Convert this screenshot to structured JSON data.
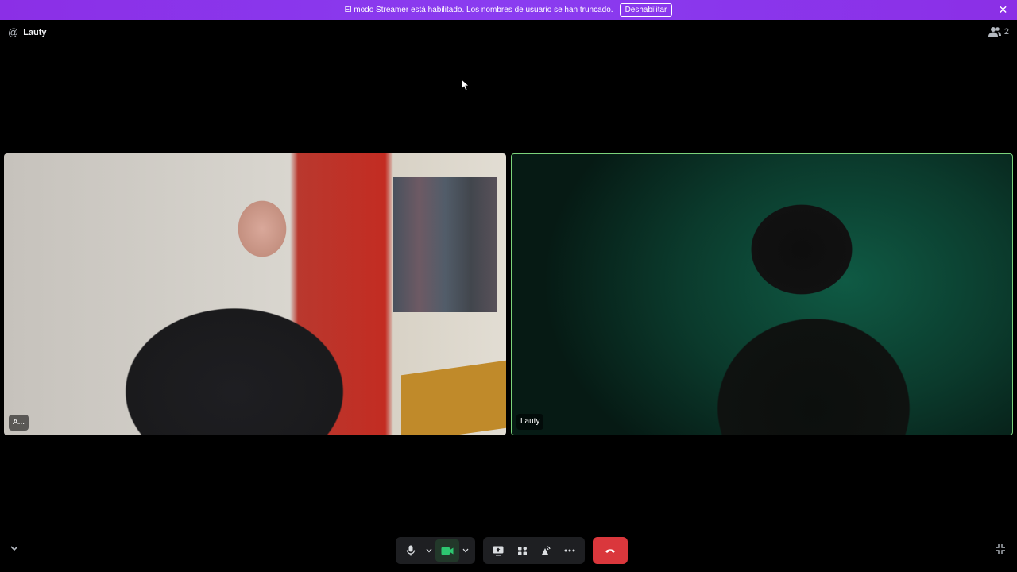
{
  "banner": {
    "message": "El modo Streamer está habilitado. Los nombres de usuario se han truncado.",
    "button_label": "Deshabilitar",
    "background": "#8a3cf0"
  },
  "header": {
    "channel_name": "Lauty",
    "channel_icon": "at-icon",
    "member_count": "2",
    "member_icon": "people-icon"
  },
  "tiles": [
    {
      "label": "A...",
      "speaking": false
    },
    {
      "label": "Lauty",
      "speaking": true,
      "speaking_color": "#7bd37b"
    }
  ],
  "controls": {
    "microphone": "microphone-icon",
    "camera": "camera-icon",
    "camera_active_color": "#2dc770",
    "screen_share": "screen-share-icon",
    "activities": "activities-icon",
    "soundboard": "soundboard-icon",
    "more": "more-icon",
    "end_call": "end-call-icon",
    "end_call_color": "#da373c"
  }
}
